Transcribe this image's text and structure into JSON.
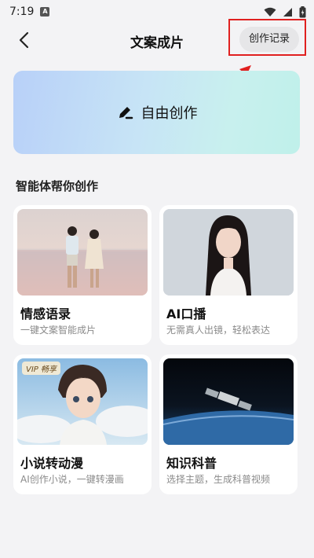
{
  "status_bar": {
    "time": "7:19",
    "app_icon": "A"
  },
  "header": {
    "title": "文案成片",
    "history_button": "创作记录",
    "back_icon": "chevron-left-icon"
  },
  "free_create": {
    "label": "自由创作",
    "icon": "pen-icon"
  },
  "section": {
    "title": "智能体帮你创作"
  },
  "cards": [
    {
      "title": "情感语录",
      "desc": "一键文案智能成片"
    },
    {
      "title": "AI口播",
      "desc": "无需真人出镜，轻松表达"
    },
    {
      "title": "小说转动漫",
      "desc": "AI创作小说，一键转漫画",
      "badge": "VIP 畅享"
    },
    {
      "title": "知识科普",
      "desc": "选择主题，生成科普视频"
    }
  ],
  "colors": {
    "highlight": "#e02020",
    "background": "#f3f3f5"
  }
}
